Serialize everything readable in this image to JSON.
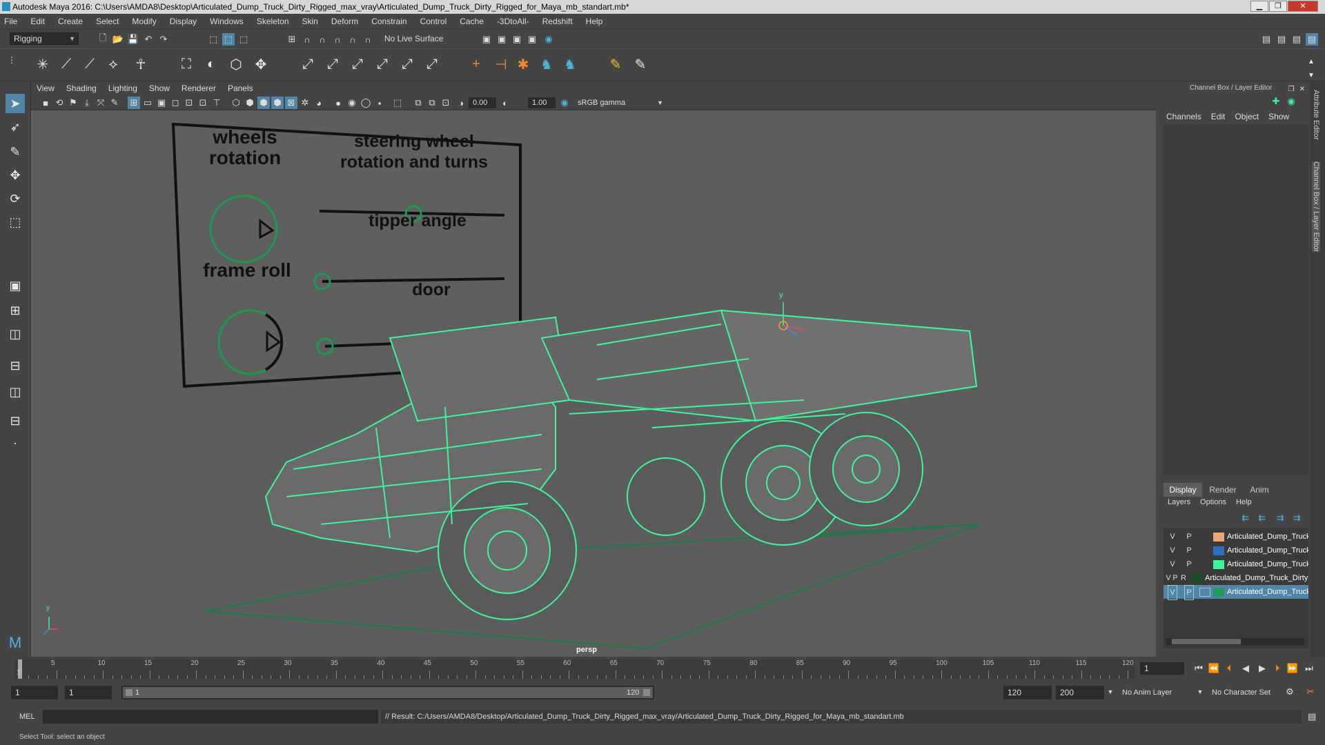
{
  "window": {
    "title": "Autodesk Maya 2016: C:\\Users\\AMDA8\\Desktop\\Articulated_Dump_Truck_Dirty_Rigged_max_vray\\Articulated_Dump_Truck_Dirty_Rigged_for_Maya_mb_standart.mb*",
    "minimize": "▁",
    "maximize": "❐",
    "close": "✕"
  },
  "menubar": [
    "File",
    "Edit",
    "Create",
    "Select",
    "Modify",
    "Display",
    "Windows",
    "Skeleton",
    "Skin",
    "Deform",
    "Constrain",
    "Control",
    "Cache",
    "-3DtoAll-",
    "Redshift",
    "Help"
  ],
  "statusline": {
    "menuset": "Rigging",
    "live_surface": "No Live Surface"
  },
  "panel": {
    "menus": [
      "View",
      "Shading",
      "Lighting",
      "Show",
      "Renderer",
      "Panels"
    ],
    "near_value": "0.00",
    "far_value": "1.00",
    "color_space": "sRGB gamma",
    "camera_label": "persp"
  },
  "controls_board": {
    "wheels_rotation": "wheels rotation",
    "steering": "steering wheel rotation and turns",
    "tipper": "tipper angle",
    "frame_roll": "frame roll",
    "door": "door"
  },
  "channel_box": {
    "header": "Channel Box / Layer Editor",
    "menus": [
      "Channels",
      "Edit",
      "Object",
      "Show"
    ]
  },
  "side_tabs": [
    "Attribute Editor",
    "Channel Box / Layer Editor"
  ],
  "layer_editor": {
    "tabs": [
      "Display",
      "Render",
      "Anim"
    ],
    "menus": [
      "Layers",
      "Options",
      "Help"
    ],
    "rows": [
      {
        "v": "V",
        "p": "P",
        "r": "",
        "color": "#e8a878",
        "name": "Articulated_Dump_Truck",
        "selected": false
      },
      {
        "v": "V",
        "p": "P",
        "r": "",
        "color": "#2d6ec0",
        "name": "Articulated_Dump_Truck",
        "selected": false
      },
      {
        "v": "V",
        "p": "P",
        "r": "",
        "color": "#3ff59c",
        "name": "Articulated_Dump_Truck",
        "selected": false
      },
      {
        "v": "V",
        "p": "P",
        "r": "R",
        "color": "#1a4a2a",
        "name": "Articulated_Dump_Truck_Dirty",
        "selected": false
      },
      {
        "v": "V",
        "p": "P",
        "r": "",
        "color": "#1f9a5a",
        "name": "Articulated_Dump_Truck",
        "selected": true
      }
    ]
  },
  "timeline": {
    "ticks": [
      "5",
      "10",
      "15",
      "20",
      "25",
      "30",
      "35",
      "40",
      "45",
      "50",
      "55",
      "60",
      "65",
      "70",
      "75",
      "80",
      "85",
      "90",
      "95",
      "100",
      "105",
      "110",
      "115",
      "120"
    ],
    "start_tick": "1",
    "current_frame": "1"
  },
  "range": {
    "start": "1",
    "playback_start": "1",
    "slider_start": "1",
    "slider_end": "120",
    "playback_end": "120",
    "end": "200",
    "anim_layer": "No Anim Layer",
    "character_set": "No Character Set"
  },
  "command": {
    "lang": "MEL",
    "result": "// Result: C:/Users/AMDA8/Desktop/Articulated_Dump_Truck_Dirty_Rigged_max_vray/Articulated_Dump_Truck_Dirty_Rigged_for_Maya_mb_standart.mb"
  },
  "help_line": "Select Tool: select an object",
  "colors": {
    "wireframe": "#3ff59c",
    "ui_bg": "#444444",
    "viewport_bg": "#5d5d5d",
    "highlight": "#5285a6"
  }
}
